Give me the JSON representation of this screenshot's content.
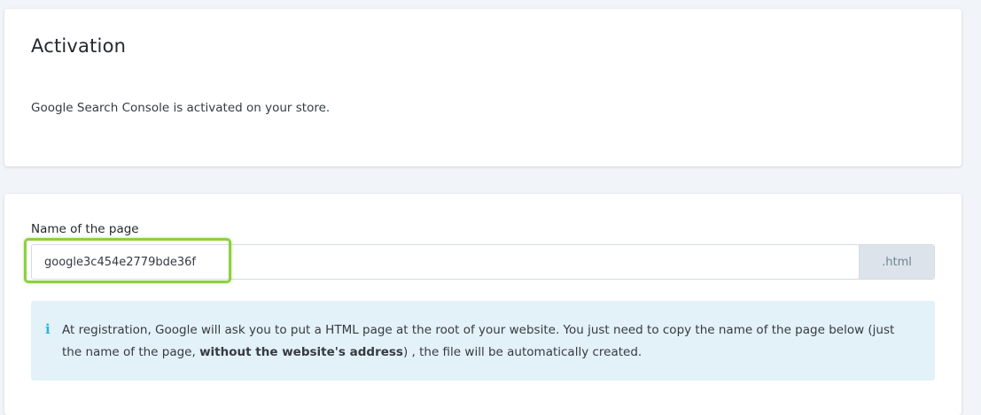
{
  "activation": {
    "title": "Activation",
    "status_text": "Google Search Console is activated on your store."
  },
  "settings": {
    "page_name_label": "Name of the page",
    "page_name_value": "google3c454e2779bde36f",
    "extension_addon": ".html",
    "info": {
      "icon": "info-icon",
      "text_before": "At registration, Google will ask you to put a HTML page at the root of your website. You just need to copy the name of the page below (just the name of the page, ",
      "text_bold": "without the website's address",
      "text_after": ") , the file will be automatically created."
    }
  },
  "colors": {
    "highlight": "#8dcf3f",
    "info_background": "#e3f1f8",
    "info_icon": "#25b9d7"
  }
}
